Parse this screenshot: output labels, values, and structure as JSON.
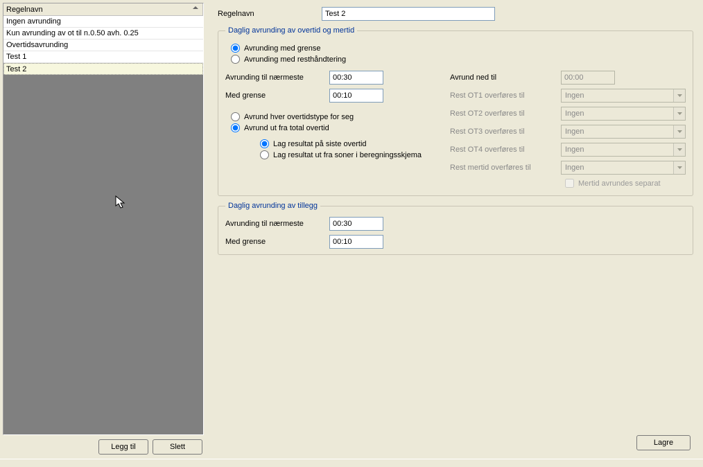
{
  "list": {
    "header": "Regelnavn",
    "items": [
      "Ingen avrunding",
      "Kun avrunding av ot til n.0.50 avh. 0.25",
      "Overtidsavrunding",
      "Test 1",
      "Test 2"
    ],
    "selectedIndex": 4,
    "addLabel": "Legg til",
    "deleteLabel": "Slett"
  },
  "form": {
    "nameLabel": "Regelnavn",
    "nameValue": "Test 2"
  },
  "group1": {
    "legend": "Daglig avrunding av overtid og mertid",
    "opt1": "Avrunding med grense",
    "opt2": "Avrunding med resthåndtering",
    "roundToLabel": "Avrunding til nærmeste",
    "roundToValue": "00:30",
    "withLimitLabel": "Med grense",
    "withLimitValue": "00:10",
    "roundDownLabel": "Avrund ned til",
    "roundDownValue": "00:00",
    "perTypeLabel": "Avrund hver overtidstype for seg",
    "fromTotalLabel": "Avrund ut fra total overtid",
    "sub1": "Lag resultat på siste overtid",
    "sub2": "Lag resultat ut fra soner i beregningsskjema",
    "restLabels": [
      "Rest OT1 overføres til",
      "Rest OT2 overføres til",
      "Rest OT3 overføres til",
      "Rest OT4 overføres til",
      "Rest mertid overføres til"
    ],
    "restValue": "Ingen",
    "mertidSeparate": "Mertid avrundes separat"
  },
  "group2": {
    "legend": "Daglig avrunding av tillegg",
    "roundToLabel": "Avrunding til nærmeste",
    "roundToValue": "00:30",
    "withLimitLabel": "Med grense",
    "withLimitValue": "00:10"
  },
  "saveLabel": "Lagre"
}
